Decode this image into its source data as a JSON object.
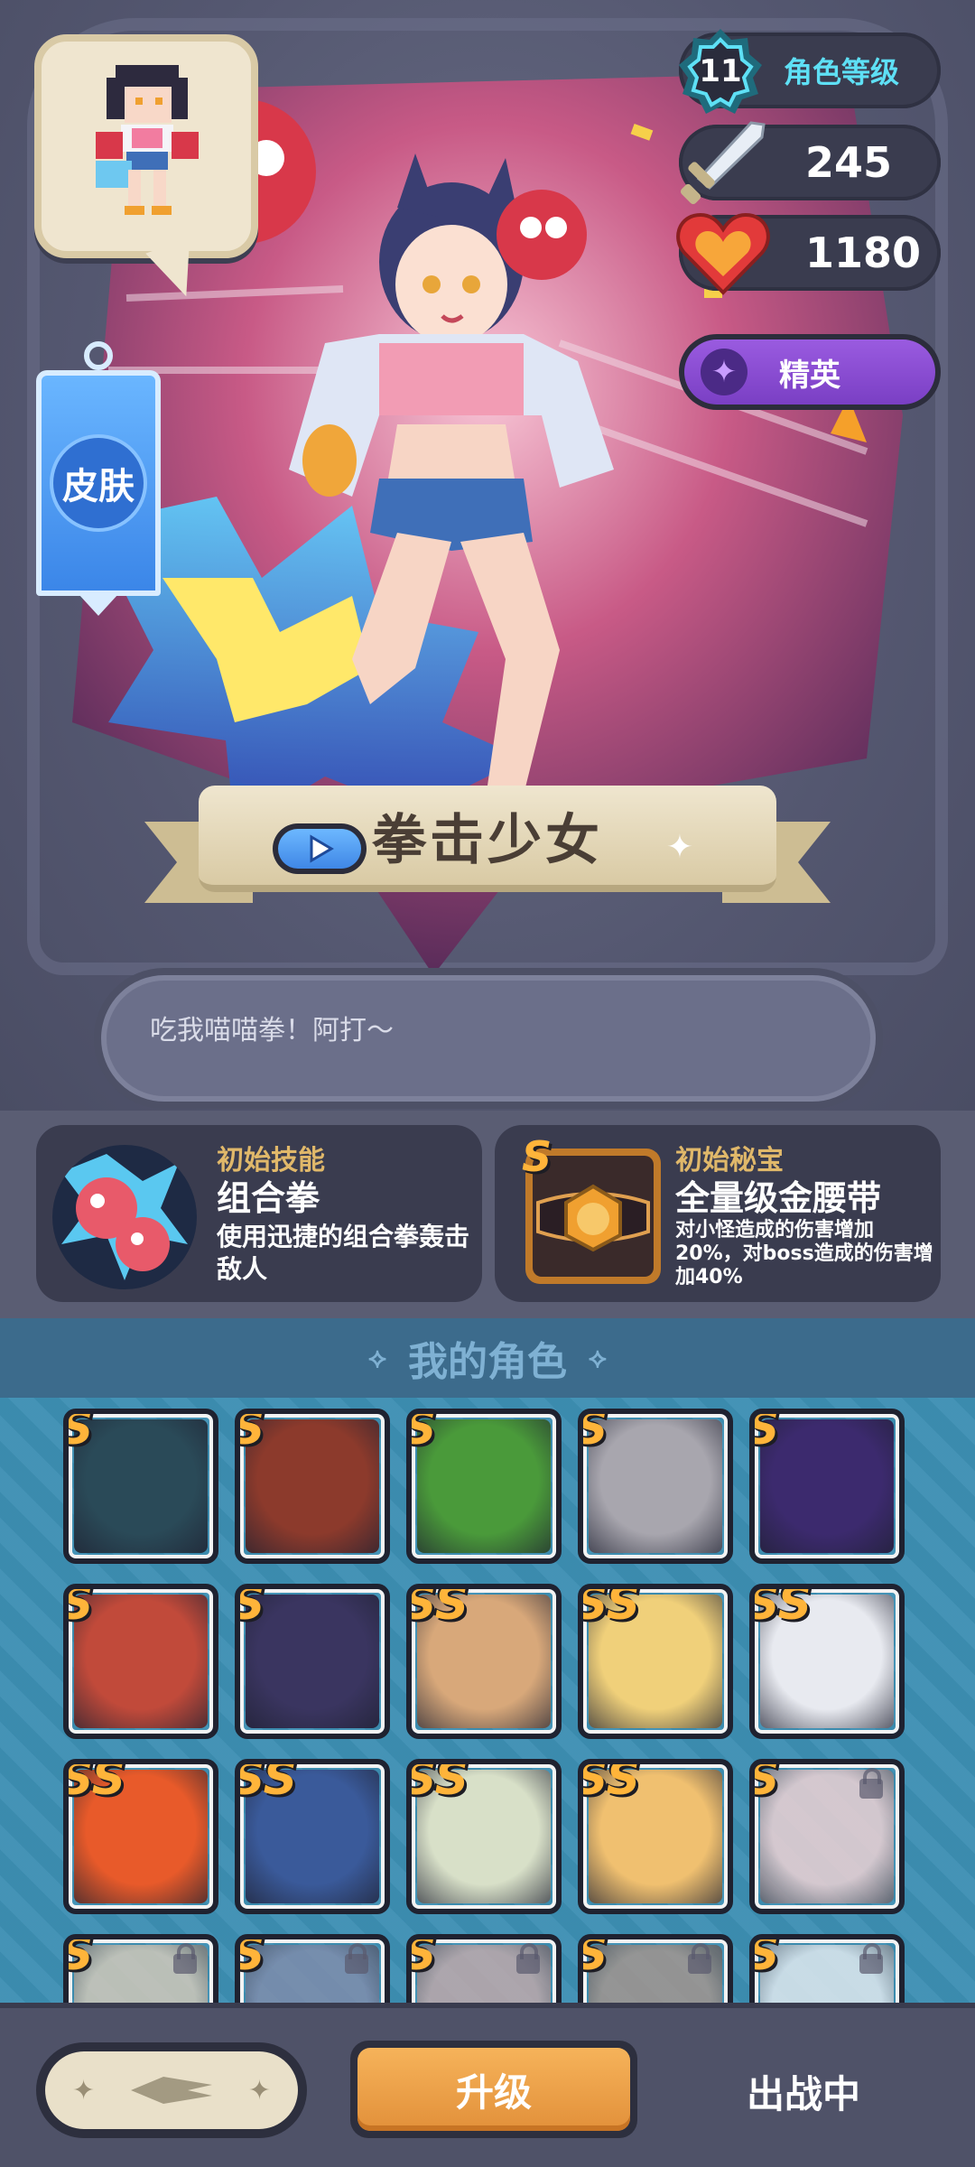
{
  "hero": {
    "level": "11",
    "level_label": "角色等级",
    "attack": "245",
    "hp": "1180",
    "rank": "精英",
    "skin_label": "皮肤",
    "character_name": "拳击少女",
    "quote": "吃我喵喵拳！阿打～"
  },
  "skill_card": {
    "category": "初始技能",
    "title": "组合拳",
    "description": "使用迅捷的组合拳轰击敌人"
  },
  "treasure_card": {
    "badge": "S",
    "category": "初始秘宝",
    "title": "全量级金腰带",
    "description": "对小怪造成的伤害增加20%，对boss造成的伤害增加40%"
  },
  "roster": {
    "title": "我的角色",
    "characters": [
      {
        "badge": "S",
        "locked": false,
        "color": "#2a4a58"
      },
      {
        "badge": "S",
        "locked": false,
        "color": "#8c3a2c"
      },
      {
        "badge": "S",
        "locked": false,
        "color": "#4a9a3a"
      },
      {
        "badge": "S",
        "locked": false,
        "color": "#a8a6ae"
      },
      {
        "badge": "S",
        "locked": false,
        "color": "#3c2a6e"
      },
      {
        "badge": "S",
        "locked": false,
        "color": "#c14a3a"
      },
      {
        "badge": "S",
        "locked": false,
        "color": "#3a3560"
      },
      {
        "badge": "SS",
        "locked": false,
        "color": "#d8a87a"
      },
      {
        "badge": "SS",
        "locked": false,
        "color": "#f0d07a"
      },
      {
        "badge": "SS",
        "locked": false,
        "color": "#e8eaf0"
      },
      {
        "badge": "SS",
        "locked": false,
        "color": "#e85a2a"
      },
      {
        "badge": "SS",
        "locked": false,
        "color": "#3a5a9a"
      },
      {
        "badge": "SS",
        "locked": false,
        "color": "#d8e0c8"
      },
      {
        "badge": "SS",
        "locked": false,
        "color": "#f0c070"
      },
      {
        "badge": "S",
        "locked": true,
        "color": "#f0b4b4"
      },
      {
        "badge": "S",
        "locked": true,
        "color": "#c8b090"
      },
      {
        "badge": "S",
        "locked": true,
        "color": "#6a7ab0"
      },
      {
        "badge": "S",
        "locked": true,
        "color": "#c09090"
      },
      {
        "badge": "S",
        "locked": true,
        "color": "#a08070"
      },
      {
        "badge": "S",
        "locked": true,
        "color": "#c8d0d8"
      }
    ]
  },
  "bottom_bar": {
    "upgrade_label": "升级",
    "deployed_label": "出战中"
  }
}
